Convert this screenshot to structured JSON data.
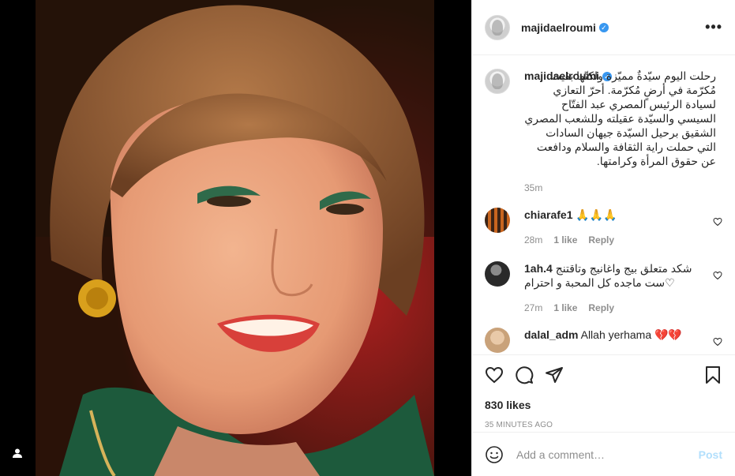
{
  "post": {
    "username": "majidaelroumi",
    "verified_glyph": "✓",
    "more_glyph": "•••",
    "caption": "رحلت اليوم سيّدةٌ مميّزة ولكنّها بقيت مُكرّمة في أرضٍ مُكرّمة. أحرّ التعازي لسيادة الرئيس المصري عبد الفتّاح السيسي والسيّدة عقيلته وللشعب المصري الشقيق برحيل السيّدة جيهان السادات التي حملت راية الثقافة والسلام ودافعت عن حقوق المرأة وكرامتها.",
    "caption_time": "35m"
  },
  "comments": [
    {
      "username": "chiarafe1",
      "text": "🙏🙏🙏",
      "time": "28m",
      "likes": "1 like",
      "reply": "Reply"
    },
    {
      "username": "1ah.4",
      "text": "شكد متعلق بيج واغانيج وتاقتنج ست ماجده كل المحبة و احترام♡",
      "time": "27m",
      "likes": "1 like",
      "reply": "Reply"
    },
    {
      "username": "dalal_adm",
      "text": "Allah yerhama 💔💔",
      "time": "",
      "likes": "",
      "reply": ""
    }
  ],
  "actions": {
    "likes": "830 likes",
    "posted": "35 MINUTES AGO"
  },
  "add_comment": {
    "placeholder": "Add a comment…",
    "post_label": "Post"
  },
  "colors": {
    "accent": "#3897f0",
    "post_disabled": "#b2dffc",
    "muted": "#8e8e8e",
    "text": "#262626"
  },
  "icons": [
    "user-tag-icon",
    "verified-icon",
    "more-options-icon",
    "heart-icon",
    "comment-icon",
    "share-icon",
    "bookmark-icon",
    "emoji-icon"
  ]
}
